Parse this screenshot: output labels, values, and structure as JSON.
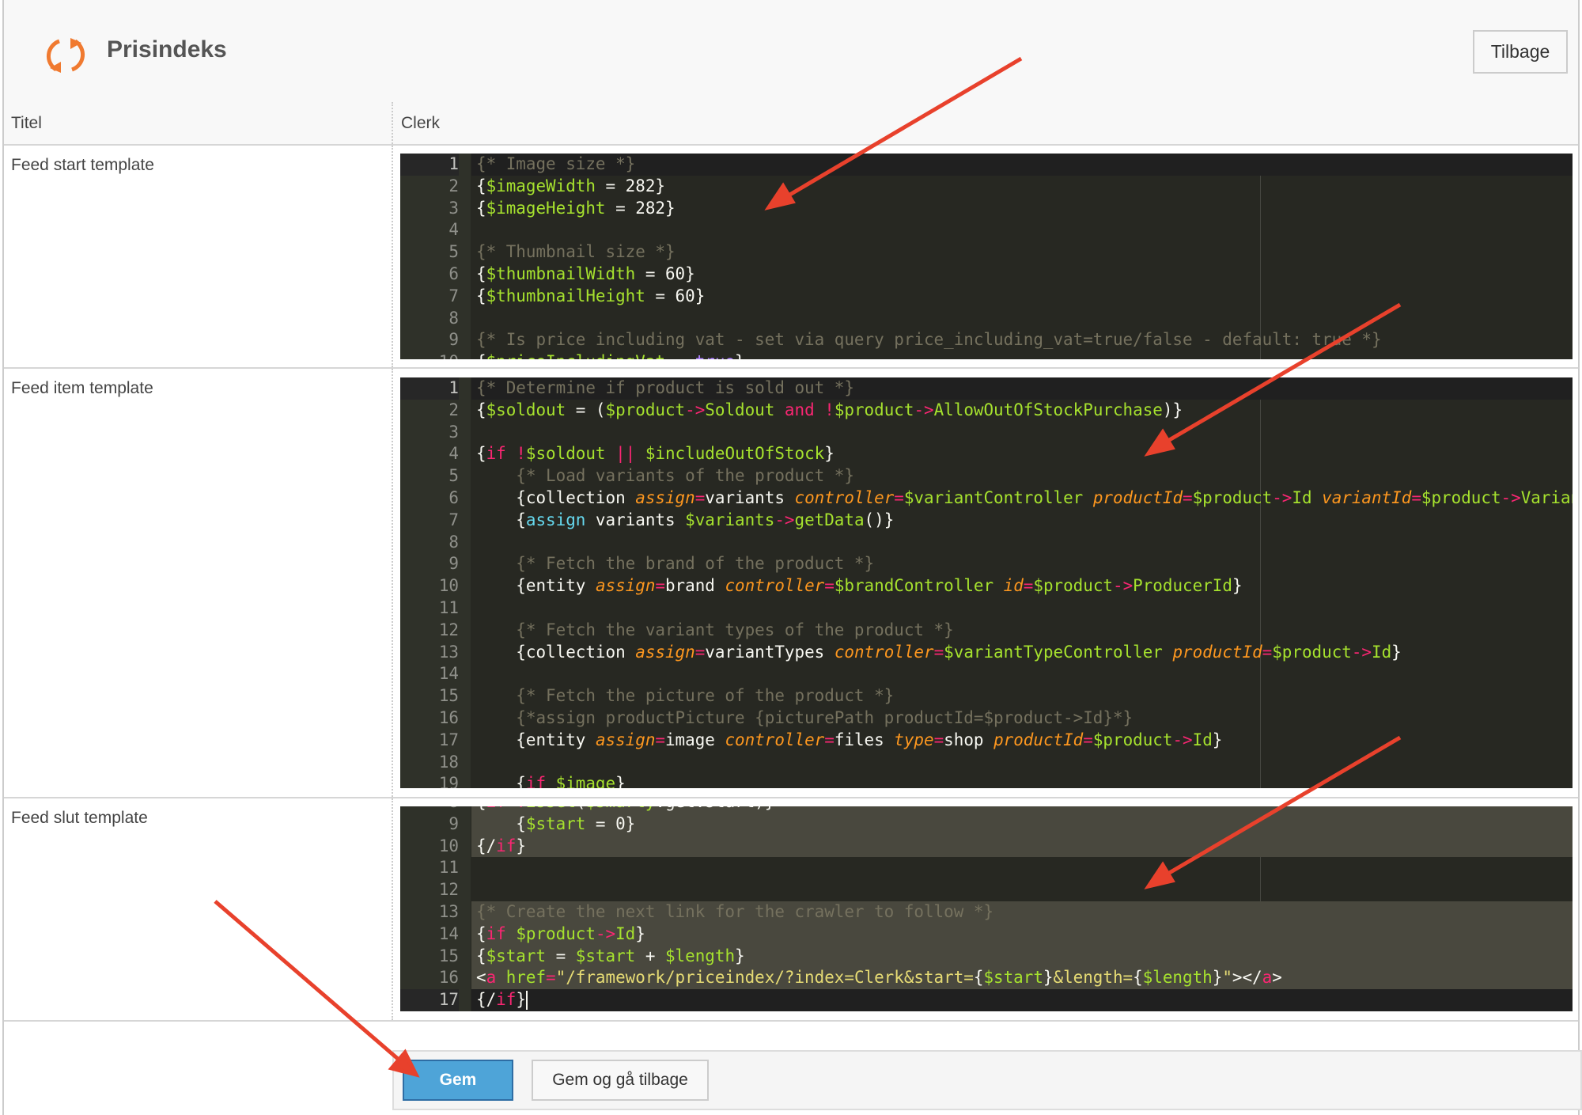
{
  "header": {
    "title": "Prisindeks",
    "back_label": "Tilbage",
    "icon": "sync-icon",
    "icon_color": "#f07a30"
  },
  "table": {
    "header": {
      "label": "Titel",
      "value": "Clerk"
    },
    "rows": [
      {
        "label": "Feed start template"
      },
      {
        "label": "Feed item template"
      },
      {
        "label": "Feed slut template"
      }
    ]
  },
  "editors": [
    {
      "lines": [
        {
          "n": "1",
          "tokens": [
            [
              "c",
              "{* Image size *}"
            ]
          ]
        },
        {
          "n": "2",
          "tokens": [
            [
              "p",
              "{"
            ],
            [
              "v",
              "$imageWidth"
            ],
            [
              "p",
              " = 282}"
            ]
          ]
        },
        {
          "n": "3",
          "tokens": [
            [
              "p",
              "{"
            ],
            [
              "v",
              "$imageHeight"
            ],
            [
              "p",
              " = 282}"
            ]
          ]
        },
        {
          "n": "4",
          "tokens": []
        },
        {
          "n": "5",
          "tokens": [
            [
              "c",
              "{* Thumbnail size *}"
            ]
          ]
        },
        {
          "n": "6",
          "tokens": [
            [
              "p",
              "{"
            ],
            [
              "v",
              "$thumbnailWidth"
            ],
            [
              "p",
              " = 60}"
            ]
          ]
        },
        {
          "n": "7",
          "tokens": [
            [
              "p",
              "{"
            ],
            [
              "v",
              "$thumbnailHeight"
            ],
            [
              "p",
              " = 60}"
            ]
          ]
        },
        {
          "n": "8",
          "tokens": []
        },
        {
          "n": "9",
          "tokens": [
            [
              "c",
              "{* Is price including vat - set via query price_including_vat=true/false - default: true *}"
            ]
          ]
        },
        {
          "n": "10",
          "tokens": [
            [
              "p",
              "{"
            ],
            [
              "v",
              "$priceIncludingVat"
            ],
            [
              "p",
              " = "
            ],
            [
              "n",
              "true"
            ],
            [
              "p",
              "}"
            ]
          ]
        }
      ]
    },
    {
      "lines": [
        {
          "n": "1",
          "tokens": [
            [
              "c",
              "{* Determine if product is sold out *}"
            ]
          ]
        },
        {
          "n": "2",
          "tokens": [
            [
              "p",
              "{"
            ],
            [
              "v",
              "$soldout"
            ],
            [
              "p",
              " = ("
            ],
            [
              "v",
              "$product"
            ],
            [
              "o",
              "->"
            ],
            [
              "v",
              "Soldout"
            ],
            [
              "p",
              " "
            ],
            [
              "k",
              "and"
            ],
            [
              "p",
              " "
            ],
            [
              "o",
              "!"
            ],
            [
              "v",
              "$product"
            ],
            [
              "o",
              "->"
            ],
            [
              "v",
              "AllowOutOfStockPurchase"
            ],
            [
              "p",
              ")}"
            ]
          ]
        },
        {
          "n": "3",
          "tokens": []
        },
        {
          "n": "4",
          "tokens": [
            [
              "p",
              "{"
            ],
            [
              "k",
              "if"
            ],
            [
              "p",
              " "
            ],
            [
              "o",
              "!"
            ],
            [
              "v",
              "$soldout"
            ],
            [
              "p",
              " "
            ],
            [
              "o",
              "||"
            ],
            [
              "p",
              " "
            ],
            [
              "v",
              "$includeOutOfStock"
            ],
            [
              "p",
              "}"
            ]
          ]
        },
        {
          "n": "5",
          "tokens": [
            [
              "c",
              "    {* Load variants of the product *}"
            ]
          ]
        },
        {
          "n": "6",
          "tokens": [
            [
              "p",
              "    {collection "
            ],
            [
              "a",
              "assign"
            ],
            [
              "o",
              "="
            ],
            [
              "p",
              "variants "
            ],
            [
              "a",
              "controller"
            ],
            [
              "o",
              "="
            ],
            [
              "v",
              "$variantController"
            ],
            [
              "p",
              " "
            ],
            [
              "a",
              "productId"
            ],
            [
              "o",
              "="
            ],
            [
              "v",
              "$product"
            ],
            [
              "o",
              "->"
            ],
            [
              "v",
              "Id"
            ],
            [
              "p",
              " "
            ],
            [
              "a",
              "variantId"
            ],
            [
              "o",
              "="
            ],
            [
              "v",
              "$product"
            ],
            [
              "o",
              "->"
            ],
            [
              "v",
              "Variant"
            ]
          ]
        },
        {
          "n": "7",
          "tokens": [
            [
              "p",
              "    {"
            ],
            [
              "b",
              "assign"
            ],
            [
              "p",
              " variants "
            ],
            [
              "v",
              "$variants"
            ],
            [
              "o",
              "->"
            ],
            [
              "v",
              "getData"
            ],
            [
              "p",
              "()}"
            ]
          ]
        },
        {
          "n": "8",
          "tokens": []
        },
        {
          "n": "9",
          "tokens": [
            [
              "c",
              "    {* Fetch the brand of the product *}"
            ]
          ]
        },
        {
          "n": "10",
          "tokens": [
            [
              "p",
              "    {entity "
            ],
            [
              "a",
              "assign"
            ],
            [
              "o",
              "="
            ],
            [
              "p",
              "brand "
            ],
            [
              "a",
              "controller"
            ],
            [
              "o",
              "="
            ],
            [
              "v",
              "$brandController"
            ],
            [
              "p",
              " "
            ],
            [
              "a",
              "id"
            ],
            [
              "o",
              "="
            ],
            [
              "v",
              "$product"
            ],
            [
              "o",
              "->"
            ],
            [
              "v",
              "ProducerId"
            ],
            [
              "p",
              "}"
            ]
          ]
        },
        {
          "n": "11",
          "tokens": []
        },
        {
          "n": "12",
          "tokens": [
            [
              "c",
              "    {* Fetch the variant types of the product *}"
            ]
          ]
        },
        {
          "n": "13",
          "tokens": [
            [
              "p",
              "    {collection "
            ],
            [
              "a",
              "assign"
            ],
            [
              "o",
              "="
            ],
            [
              "p",
              "variantTypes "
            ],
            [
              "a",
              "controller"
            ],
            [
              "o",
              "="
            ],
            [
              "v",
              "$variantTypeController"
            ],
            [
              "p",
              " "
            ],
            [
              "a",
              "productId"
            ],
            [
              "o",
              "="
            ],
            [
              "v",
              "$product"
            ],
            [
              "o",
              "->"
            ],
            [
              "v",
              "Id"
            ],
            [
              "p",
              "}"
            ]
          ]
        },
        {
          "n": "14",
          "tokens": []
        },
        {
          "n": "15",
          "tokens": [
            [
              "c",
              "    {* Fetch the picture of the product *}"
            ]
          ]
        },
        {
          "n": "16",
          "tokens": [
            [
              "c",
              "    {*assign productPicture {picturePath productId=$product->Id}*}"
            ]
          ]
        },
        {
          "n": "17",
          "tokens": [
            [
              "p",
              "    {entity "
            ],
            [
              "a",
              "assign"
            ],
            [
              "o",
              "="
            ],
            [
              "p",
              "image "
            ],
            [
              "a",
              "controller"
            ],
            [
              "o",
              "="
            ],
            [
              "p",
              "files "
            ],
            [
              "a",
              "type"
            ],
            [
              "o",
              "="
            ],
            [
              "p",
              "shop "
            ],
            [
              "a",
              "productId"
            ],
            [
              "o",
              "="
            ],
            [
              "v",
              "$product"
            ],
            [
              "o",
              "->"
            ],
            [
              "v",
              "Id"
            ],
            [
              "p",
              "}"
            ]
          ]
        },
        {
          "n": "18",
          "tokens": []
        },
        {
          "n": "19",
          "tokens": [
            [
              "p",
              "    {"
            ],
            [
              "k",
              "if"
            ],
            [
              "p",
              " "
            ],
            [
              "v",
              "$image"
            ],
            [
              "p",
              "}"
            ]
          ]
        }
      ]
    },
    {
      "lines": [
        {
          "n": "8",
          "tokens": [
            [
              "p",
              "{"
            ],
            [
              "k",
              "if"
            ],
            [
              "p",
              " "
            ],
            [
              "o",
              "!"
            ],
            [
              "v",
              "isset"
            ],
            [
              "p",
              "("
            ],
            [
              "v",
              "$smarty"
            ],
            [
              "p",
              ".get.start)}"
            ]
          ]
        },
        {
          "n": "9",
          "tokens": [
            [
              "p",
              "    {"
            ],
            [
              "v",
              "$start"
            ],
            [
              "p",
              " = 0}"
            ]
          ]
        },
        {
          "n": "10",
          "tokens": [
            [
              "p",
              "{/"
            ],
            [
              "k",
              "if"
            ],
            [
              "p",
              "}"
            ]
          ]
        },
        {
          "n": "11",
          "tokens": []
        },
        {
          "n": "12",
          "tokens": []
        },
        {
          "n": "13",
          "tokens": [
            [
              "c",
              "{* Create the next link for the crawler to follow *}"
            ]
          ]
        },
        {
          "n": "14",
          "tokens": [
            [
              "p",
              "{"
            ],
            [
              "k",
              "if"
            ],
            [
              "p",
              " "
            ],
            [
              "v",
              "$product"
            ],
            [
              "o",
              "->"
            ],
            [
              "v",
              "Id"
            ],
            [
              "p",
              "}"
            ]
          ]
        },
        {
          "n": "15",
          "tokens": [
            [
              "p",
              "{"
            ],
            [
              "v",
              "$start"
            ],
            [
              "p",
              " = "
            ],
            [
              "v",
              "$start"
            ],
            [
              "p",
              " + "
            ],
            [
              "v",
              "$length"
            ],
            [
              "p",
              "}"
            ]
          ]
        },
        {
          "n": "16",
          "tokens": [
            [
              "p",
              "<"
            ],
            [
              "k",
              "a"
            ],
            [
              "p",
              " "
            ],
            [
              "v",
              "href"
            ],
            [
              "o",
              "="
            ],
            [
              "s",
              "\"/framework/priceindex/?index=Clerk&start="
            ],
            [
              "p",
              "{"
            ],
            [
              "v",
              "$start"
            ],
            [
              "p",
              "}"
            ],
            [
              "s",
              "&length="
            ],
            [
              "p",
              "{"
            ],
            [
              "v",
              "$length"
            ],
            [
              "p",
              "}"
            ],
            [
              "s",
              "\""
            ],
            [
              "p",
              "></"
            ],
            [
              "k",
              "a"
            ],
            [
              "p",
              ">"
            ]
          ]
        },
        {
          "n": "17",
          "tokens": [
            [
              "p",
              "{/"
            ],
            [
              "k",
              "if"
            ],
            [
              "p",
              "}"
            ]
          ]
        }
      ]
    }
  ],
  "footer": {
    "save_label": "Gem",
    "save_back_label": "Gem og gå tilbage"
  },
  "colors": {
    "accent": "#4ea4d8",
    "annotation_arrow": "#e8412c",
    "editor_bg": "#272822"
  }
}
